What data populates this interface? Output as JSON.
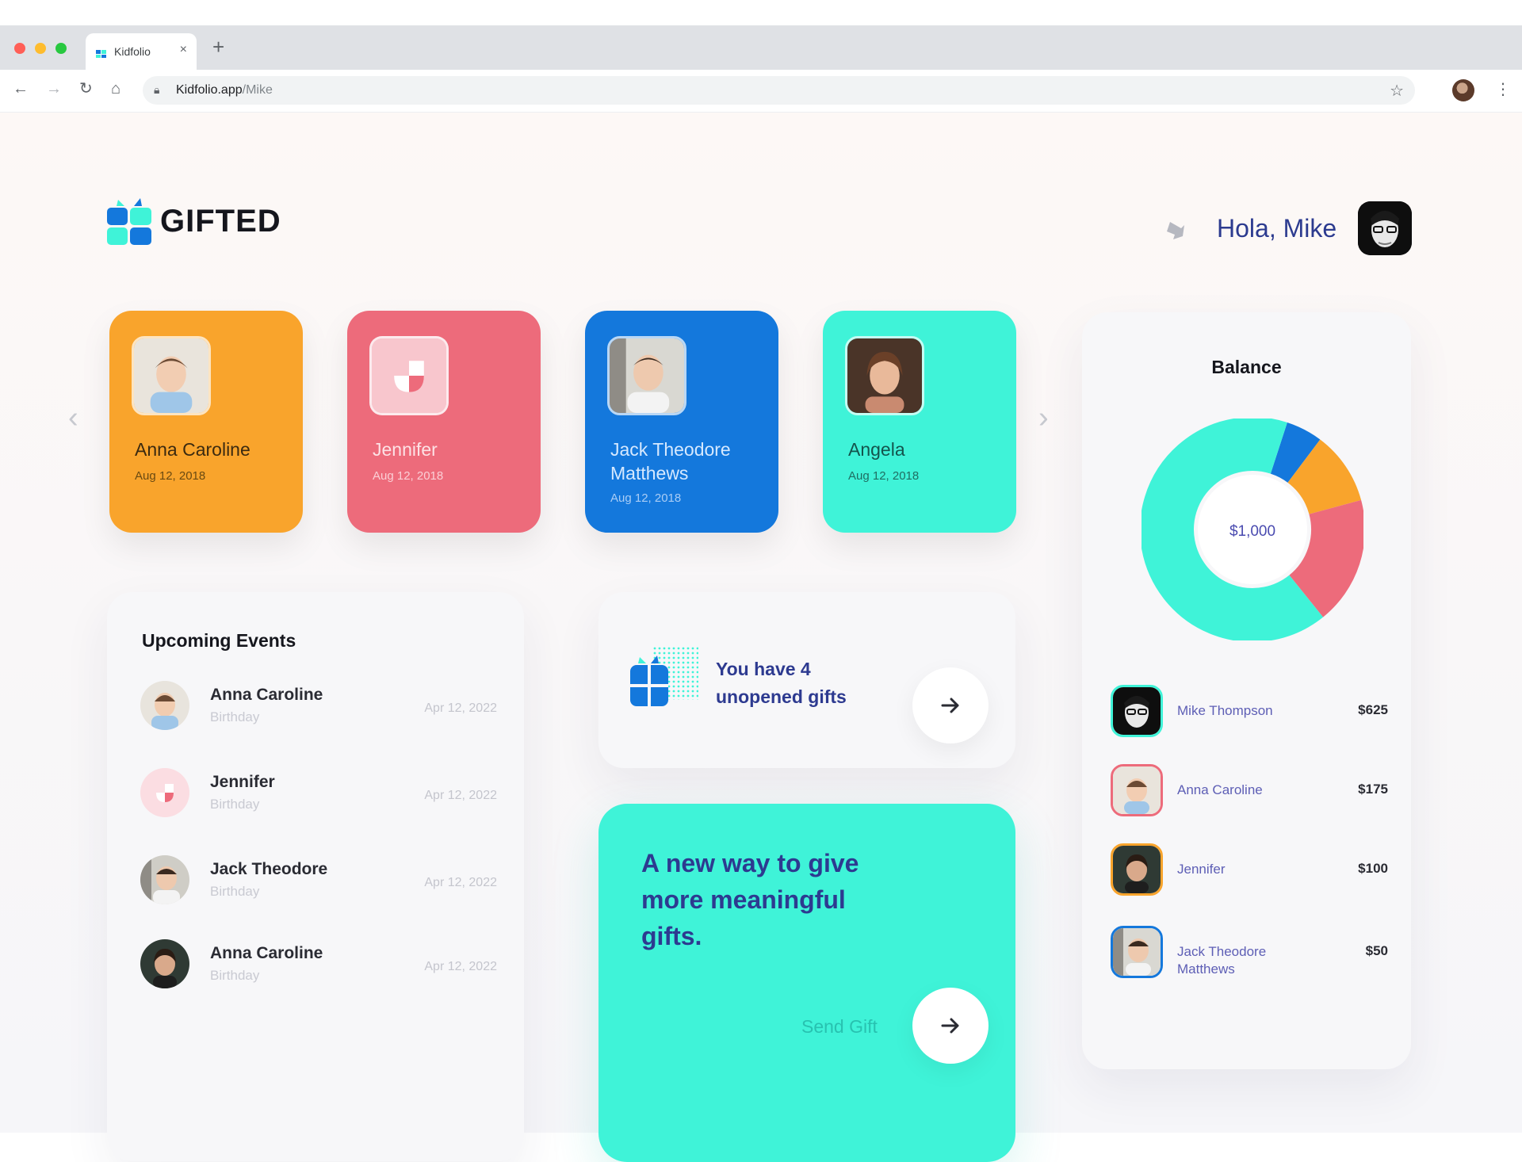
{
  "browser": {
    "tab_title": "Kidfolio",
    "tab_close": "×",
    "new_tab": "+",
    "url_host": "Kidfolio.app",
    "url_path": "/Mike"
  },
  "header": {
    "brand": "GIFTED",
    "greeting": "Hola, Mike"
  },
  "kids": [
    {
      "name": "Anna Caroline",
      "date": "Aug 12, 2018",
      "color": "#f9a42c"
    },
    {
      "name": "Jennifer",
      "date": "Aug 12, 2018",
      "color": "#ed6b7b"
    },
    {
      "name": "Jack Theodore Matthews",
      "date": "Aug 12, 2018",
      "color": "#1478dc"
    },
    {
      "name": "Angela",
      "date": "Aug 12, 2018",
      "color": "#3ff3d8"
    }
  ],
  "events": {
    "title": "Upcoming Events",
    "items": [
      {
        "name": "Anna Caroline",
        "type": "Birthday",
        "date": "Apr 12, 2022"
      },
      {
        "name": "Jennifer",
        "type": "Birthday",
        "date": "Apr 12, 2022"
      },
      {
        "name": "Jack Theodore",
        "type": "Birthday",
        "date": "Apr 12, 2022"
      },
      {
        "name": "Anna Caroline",
        "type": "Birthday",
        "date": "Apr 12, 2022"
      }
    ]
  },
  "gifts": {
    "text": "You have 4 unopened gifts"
  },
  "promo": {
    "text": "A new way to give more meaningful gifts.",
    "send_label": "Send Gift"
  },
  "balance": {
    "title": "Balance",
    "total": "$1,000",
    "items": [
      {
        "name": "Mike Thompson",
        "amount": "$625",
        "color": "#3ff3d8"
      },
      {
        "name": "Anna Caroline",
        "amount": "$175",
        "color": "#ed6b7b"
      },
      {
        "name": "Jennifer",
        "amount": "$100",
        "color": "#f9a42c"
      },
      {
        "name": "Jack Theodore Matthews",
        "amount": "$50",
        "color": "#1478dc"
      }
    ]
  },
  "chart_data": {
    "type": "pie",
    "title": "Balance",
    "categories": [
      "Mike Thompson",
      "Anna Caroline",
      "Jennifer",
      "Jack Theodore Matthews"
    ],
    "values": [
      625,
      175,
      100,
      50
    ],
    "colors": [
      "#3ff3d8",
      "#ed6b7b",
      "#f9a42c",
      "#1478dc"
    ],
    "center_label": "$1,000"
  }
}
